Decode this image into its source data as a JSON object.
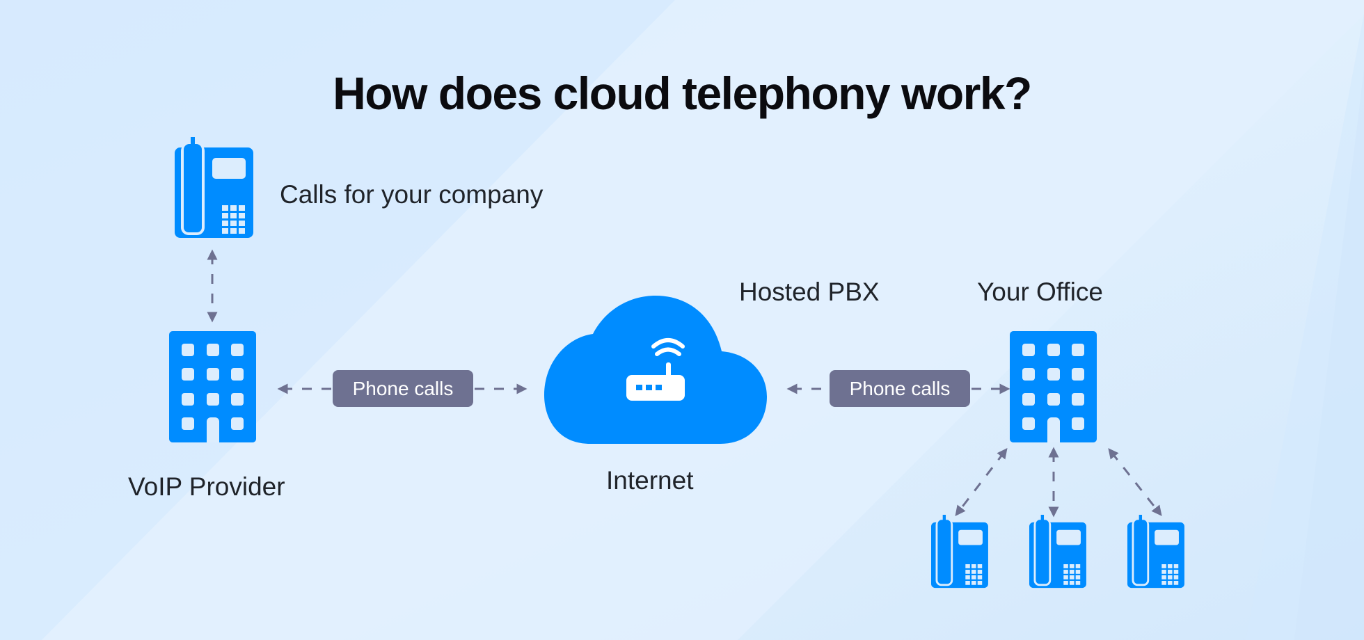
{
  "title": "How does cloud telephony work?",
  "labels": {
    "calls_for_company": "Calls for your company",
    "voip_provider": "VoIP Provider",
    "internet": "Internet",
    "hosted_pbx": "Hosted PBX",
    "your_office": "Your Office"
  },
  "connectors": {
    "left_pill": "Phone calls",
    "right_pill": "Phone calls"
  },
  "icons": {
    "top_phone": "desk-phone-icon",
    "voip_building": "building-icon",
    "cloud": "cloud-icon",
    "router": "wifi-router-icon",
    "office_building": "building-icon",
    "office_phones": [
      "desk-phone-icon",
      "desk-phone-icon",
      "desk-phone-icon"
    ]
  },
  "colors": {
    "accent_blue": "#008cff",
    "pill_gray": "#6e7191",
    "arrow_gray": "#6e7191",
    "text_dark": "#1f2329",
    "background": "#dcedfd"
  }
}
